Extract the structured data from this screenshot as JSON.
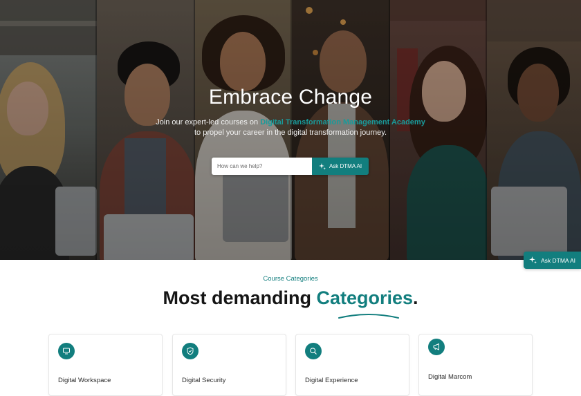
{
  "hero": {
    "title": "Embrace Change",
    "subtitle_prefix": "Join our expert-led courses on ",
    "subtitle_accent": "Digital Transformation Management Academy",
    "subtitle_suffix": "to propel your career in the digital transformation journey.",
    "search": {
      "placeholder": "How can we help?",
      "button_label": "Ask DTMA AI",
      "button_icon": "sparkle-icon"
    }
  },
  "floating_button": {
    "label": "Ask DTMA AI",
    "icon": "sparkle-icon"
  },
  "categories": {
    "eyebrow": "Course Categories",
    "heading_main": "Most demanding ",
    "heading_accent": "Categories",
    "heading_period": ".",
    "items": [
      {
        "label": "Digital Workspace",
        "icon": "monitor-icon"
      },
      {
        "label": "Digital Security",
        "icon": "shield-icon"
      },
      {
        "label": "Digital Experience",
        "icon": "magnifier-icon"
      },
      {
        "label": "Digital Marcom",
        "icon": "megaphone-icon"
      }
    ]
  },
  "colors": {
    "accent": "#127e7e",
    "heading": "#151515"
  }
}
